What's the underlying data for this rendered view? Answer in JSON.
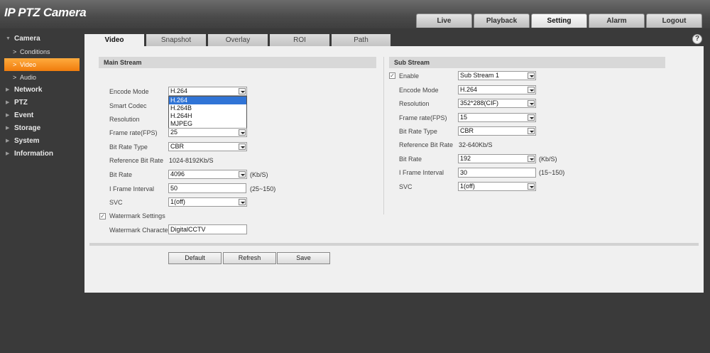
{
  "app": {
    "title": "IP PTZ Camera"
  },
  "top_tabs": [
    "Live",
    "Playback",
    "Setting",
    "Alarm",
    "Logout"
  ],
  "top_tab_active": "Setting",
  "sidebar": {
    "camera": "Camera",
    "camera_subs": [
      "Conditions",
      "Video",
      "Audio"
    ],
    "active_sub": "Video",
    "others": [
      "Network",
      "PTZ",
      "Event",
      "Storage",
      "System",
      "Information"
    ]
  },
  "sub_tabs": [
    "Video",
    "Snapshot",
    "Overlay",
    "ROI",
    "Path"
  ],
  "main_stream": {
    "title": "Main Stream",
    "encode_mode_label": "Encode Mode",
    "encode_mode_value": "H.264",
    "encode_mode_options": [
      "H.264",
      "H.264B",
      "H.264H",
      "MJPEG"
    ],
    "smart_codec_label": "Smart Codec",
    "resolution_label": "Resolution",
    "frame_rate_label": "Frame rate(FPS)",
    "frame_rate_value": "25",
    "bit_rate_type_label": "Bit Rate Type",
    "bit_rate_type_value": "CBR",
    "ref_bit_rate_label": "Reference Bit Rate",
    "ref_bit_rate_value": "1024-8192Kb/S",
    "bit_rate_label": "Bit Rate",
    "bit_rate_value": "4096",
    "bit_rate_unit": "(Kb/S)",
    "iframe_label": "I Frame Interval",
    "iframe_value": "50",
    "iframe_range": "(25~150)",
    "svc_label": "SVC",
    "svc_value": "1(off)",
    "watermark_settings_label": "Watermark Settings",
    "watermark_checked": true,
    "watermark_char_label": "Watermark Character",
    "watermark_char_value": "DigitalCCTV"
  },
  "sub_stream": {
    "title": "Sub Stream",
    "enable_label": "Enable",
    "enable_checked": true,
    "stream_value": "Sub Stream 1",
    "encode_mode_label": "Encode Mode",
    "encode_mode_value": "H.264",
    "resolution_label": "Resolution",
    "resolution_value": "352*288(CIF)",
    "frame_rate_label": "Frame rate(FPS)",
    "frame_rate_value": "15",
    "bit_rate_type_label": "Bit Rate Type",
    "bit_rate_type_value": "CBR",
    "ref_bit_rate_label": "Reference Bit Rate",
    "ref_bit_rate_value": "32-640Kb/S",
    "bit_rate_label": "Bit Rate",
    "bit_rate_value": "192",
    "bit_rate_unit": "(Kb/S)",
    "iframe_label": "I Frame Interval",
    "iframe_value": "30",
    "iframe_range": "(15~150)",
    "svc_label": "SVC",
    "svc_value": "1(off)"
  },
  "buttons": {
    "default": "Default",
    "refresh": "Refresh",
    "save": "Save"
  },
  "icons": {
    "help": "help-icon",
    "check": "checkmark-icon",
    "dropdown": "dropdown-arrow-icon"
  }
}
